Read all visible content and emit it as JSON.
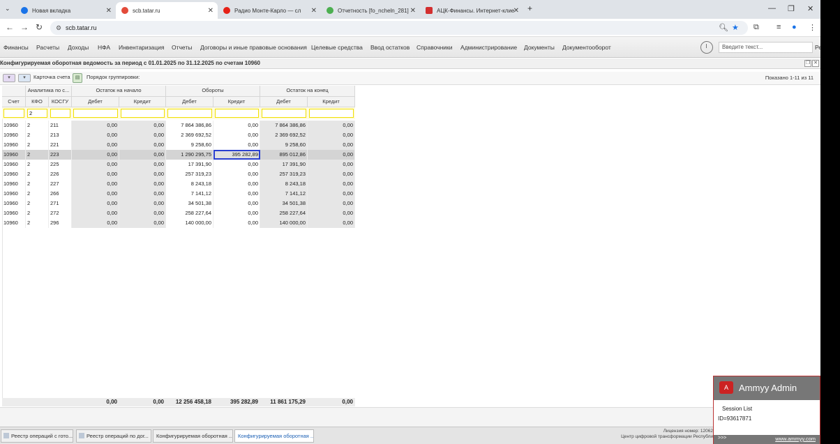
{
  "browser": {
    "tabs": [
      {
        "title": "Новая вкладка",
        "icon_color": "#1a73e8"
      },
      {
        "title": "scb.tatar.ru",
        "icon_color": "#e34b3a"
      },
      {
        "title": "Радио Монте-Карло — сл",
        "icon_color": "#e62117"
      },
      {
        "title": "Отчетность [fo_ncheln_281]",
        "icon_color": "#4caf50"
      },
      {
        "title": "АЦК-Финансы. Интернет-клие",
        "icon_color": "#d32f2f"
      }
    ],
    "new_tab_label": "+",
    "url": "scb.tatar.ru"
  },
  "menu": {
    "items": [
      "Финансы",
      "Расчеты",
      "Доходы",
      "НФА",
      "Инвентаризация",
      "Отчеты",
      "Договоры и иные правовые основания",
      "Целевые средства",
      "Ввод остатков",
      "Справочники",
      "Администрирование",
      "Документы",
      "Документооборот"
    ],
    "search_placeholder": "Введите текст...",
    "cut_label": "Ре"
  },
  "title": "Конфигурируемая оборотная ведомость за период с 01.01.2025 по 31.12.2025 по счетам 10960",
  "toolbar": {
    "account_card": "Карточка счета",
    "grouping": "Порядок группировки:",
    "shown": "Показано 1-11 из 11"
  },
  "grid": {
    "group_headers": {
      "analytics": "Аналитика по с...",
      "opening": "Остаток на начало",
      "turnover": "Обороты",
      "closing": "Остаток на конец"
    },
    "columns": [
      "Счет",
      "КФО",
      "КОСГУ",
      "Дебет",
      "Кредит",
      "Дебет",
      "Кредит",
      "Дебет",
      "Кредит"
    ],
    "filter_kfo": "2",
    "rows": [
      [
        "10960",
        "2",
        "211",
        "0,00",
        "0,00",
        "7 864 386,86",
        "0,00",
        "7 864 386,86",
        "0,00"
      ],
      [
        "10960",
        "2",
        "213",
        "0,00",
        "0,00",
        "2 369 692,52",
        "0,00",
        "2 369 692,52",
        "0,00"
      ],
      [
        "10960",
        "2",
        "221",
        "0,00",
        "0,00",
        "9 258,60",
        "0,00",
        "9 258,60",
        "0,00"
      ],
      [
        "10960",
        "2",
        "223",
        "0,00",
        "0,00",
        "1 290 295,75",
        "395 282,89",
        "895 012,86",
        "0,00"
      ],
      [
        "10960",
        "2",
        "225",
        "0,00",
        "0,00",
        "17 391,90",
        "0,00",
        "17 391,90",
        "0,00"
      ],
      [
        "10960",
        "2",
        "226",
        "0,00",
        "0,00",
        "257 319,23",
        "0,00",
        "257 319,23",
        "0,00"
      ],
      [
        "10960",
        "2",
        "227",
        "0,00",
        "0,00",
        "8 243,18",
        "0,00",
        "8 243,18",
        "0,00"
      ],
      [
        "10960",
        "2",
        "266",
        "0,00",
        "0,00",
        "7 141,12",
        "0,00",
        "7 141,12",
        "0,00"
      ],
      [
        "10960",
        "2",
        "271",
        "0,00",
        "0,00",
        "34 501,38",
        "0,00",
        "34 501,38",
        "0,00"
      ],
      [
        "10960",
        "2",
        "272",
        "0,00",
        "0,00",
        "258 227,64",
        "0,00",
        "258 227,64",
        "0,00"
      ],
      [
        "10960",
        "2",
        "296",
        "0,00",
        "0,00",
        "140 000,00",
        "0,00",
        "140 000,00",
        "0,00"
      ]
    ],
    "totals": [
      "0,00",
      "0,00",
      "12 256 458,18",
      "395 282,89",
      "11 861 175,29",
      "0,00"
    ]
  },
  "taskbar": {
    "tabs": [
      "Реестр операций с гото...",
      "Реестр операций по дог...",
      "Конфигурируемая оборотная ...",
      "Конфигурируемая оборотная ..."
    ],
    "license_line1": "Лицензия номер: 12062",
    "license_line2": "Центр цифровой трансформации Республи"
  },
  "ammyy": {
    "title": "Ammyy Admin",
    "session_list": "Session List",
    "id": "ID=93617871",
    "arrows": ">>>",
    "link": "www.ammyy.com"
  }
}
